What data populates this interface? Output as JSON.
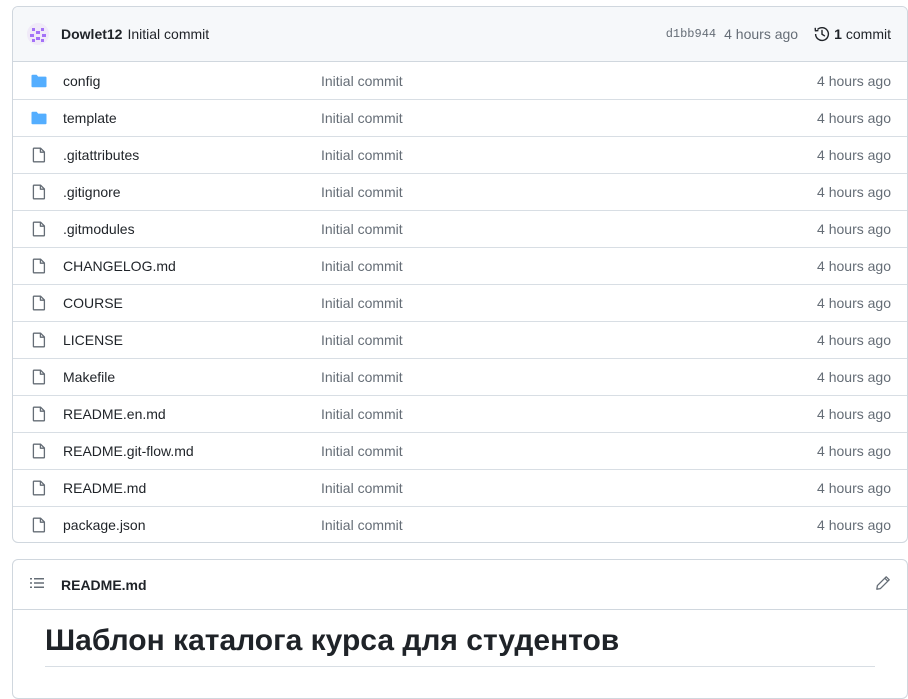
{
  "commit": {
    "author": "Dowlet12",
    "message": "Initial commit",
    "sha": "d1bb944",
    "time": "4 hours ago",
    "history_count": "1",
    "history_label": "commit"
  },
  "files": [
    {
      "name": "config",
      "type": "folder",
      "message": "Initial commit",
      "time": "4 hours ago"
    },
    {
      "name": "template",
      "type": "folder",
      "message": "Initial commit",
      "time": "4 hours ago"
    },
    {
      "name": ".gitattributes",
      "type": "file",
      "message": "Initial commit",
      "time": "4 hours ago"
    },
    {
      "name": ".gitignore",
      "type": "file",
      "message": "Initial commit",
      "time": "4 hours ago"
    },
    {
      "name": ".gitmodules",
      "type": "file",
      "message": "Initial commit",
      "time": "4 hours ago"
    },
    {
      "name": "CHANGELOG.md",
      "type": "file",
      "message": "Initial commit",
      "time": "4 hours ago"
    },
    {
      "name": "COURSE",
      "type": "file",
      "message": "Initial commit",
      "time": "4 hours ago"
    },
    {
      "name": "LICENSE",
      "type": "file",
      "message": "Initial commit",
      "time": "4 hours ago"
    },
    {
      "name": "Makefile",
      "type": "file",
      "message": "Initial commit",
      "time": "4 hours ago"
    },
    {
      "name": "README.en.md",
      "type": "file",
      "message": "Initial commit",
      "time": "4 hours ago"
    },
    {
      "name": "README.git-flow.md",
      "type": "file",
      "message": "Initial commit",
      "time": "4 hours ago"
    },
    {
      "name": "README.md",
      "type": "file",
      "message": "Initial commit",
      "time": "4 hours ago"
    },
    {
      "name": "package.json",
      "type": "file",
      "message": "Initial commit",
      "time": "4 hours ago"
    }
  ],
  "readme": {
    "filename": "README.md",
    "heading": "Шаблон каталога курса для студентов"
  },
  "colors": {
    "folder": "#54aeff",
    "file_icon": "#656d76",
    "avatar": "#a371f7",
    "border": "#d0d7de"
  },
  "icons": {
    "folder": "folder-icon",
    "file": "file-icon",
    "history": "history-icon",
    "list": "list-icon",
    "edit": "pencil-icon"
  }
}
